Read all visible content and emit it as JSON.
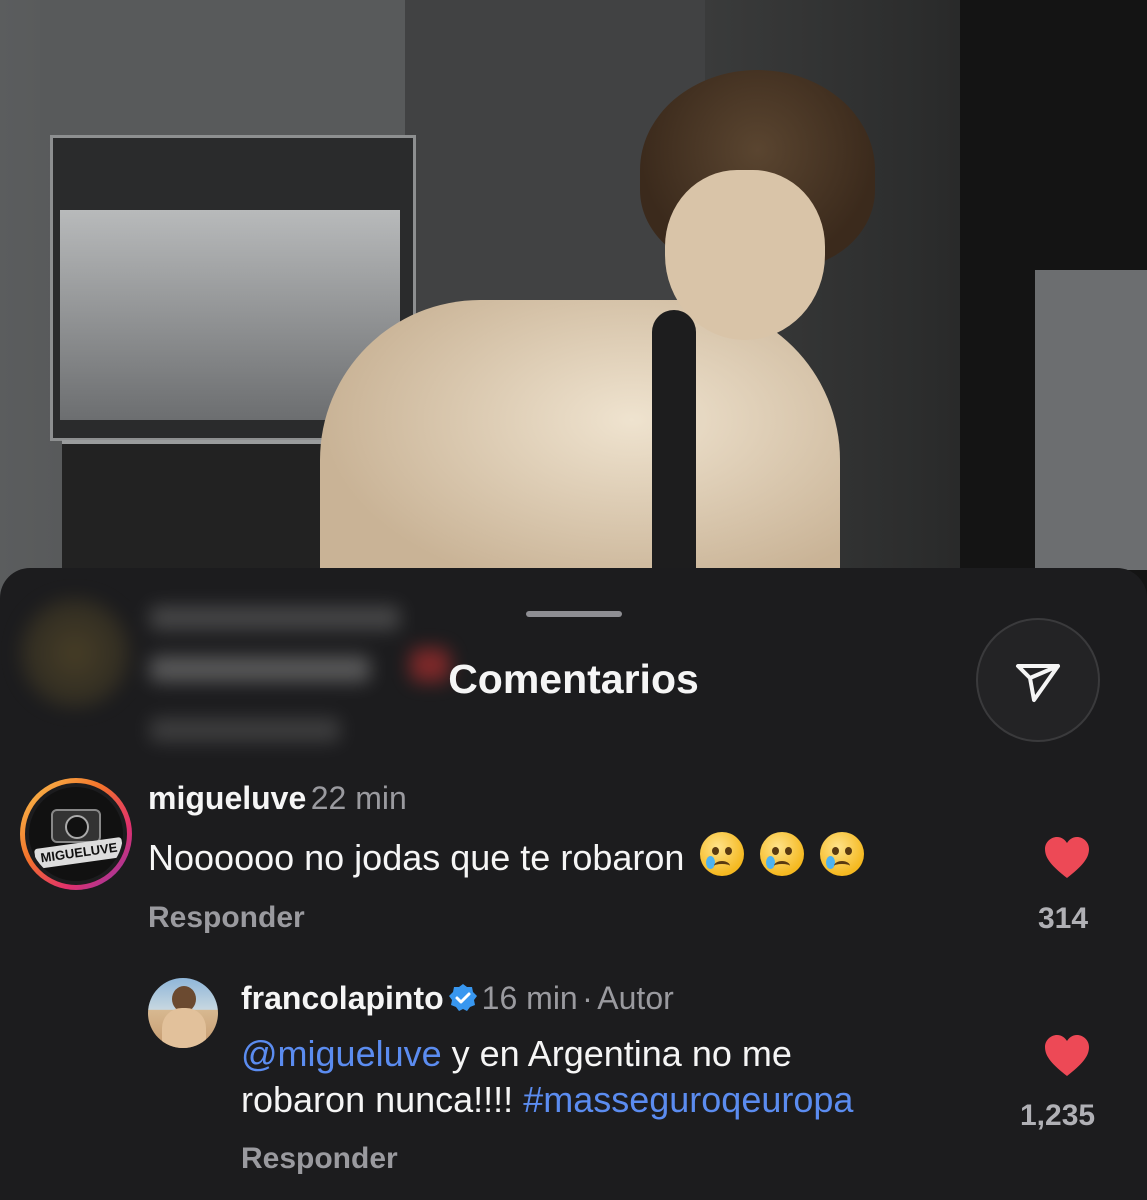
{
  "sheet": {
    "title": "Comentarios"
  },
  "comments": [
    {
      "username": "migueluve",
      "time": "22 min",
      "avatar_text": "MIGUELUVE",
      "text": "Noooooo no jodas que te robaron",
      "emojis": [
        "crying-face",
        "crying-face",
        "crying-face"
      ],
      "reply_label": "Responder",
      "likes": "314",
      "liked": true
    },
    {
      "username": "francolapinto",
      "verified": true,
      "time": "16 min",
      "separator": "·",
      "author_badge": "Autor",
      "mention": "@migueluve",
      "text_line1": " y en Argentina no me",
      "text_line2": "robaron nunca!!!! ",
      "hashtag": "#masseguroqeuropa",
      "reply_label": "Responder",
      "likes": "1,235",
      "liked": true
    }
  ],
  "colors": {
    "like": "#ed4956",
    "mention": "#5b8cf0",
    "background": "#1c1c1e"
  },
  "icons": {
    "share": "paper-plane-icon",
    "like": "heart-icon",
    "verified": "verified-badge-icon"
  }
}
